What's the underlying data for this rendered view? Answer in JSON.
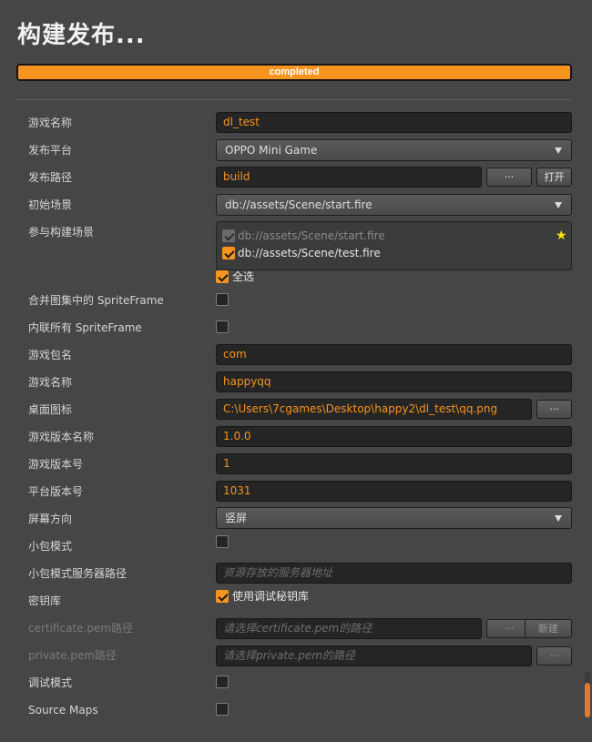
{
  "title": "构建发布...",
  "progress": {
    "text": "completed",
    "fraction": 1.0
  },
  "colors": {
    "accent": "#f7931f",
    "background": "#464646",
    "field": "#252525"
  },
  "fields": {
    "game_name_1": {
      "label": "游戏名称",
      "value": "dl_test"
    },
    "platform": {
      "label": "发布平台",
      "value": "OPPO Mini Game"
    },
    "build_path": {
      "label": "发布路径",
      "value": "build",
      "browse": "···",
      "open": "打开"
    },
    "start_scene": {
      "label": "初始场景",
      "value": "db://assets/Scene/start.fire"
    },
    "scenes": {
      "label": "参与构建场景",
      "items": [
        "db://assets/Scene/start.fire",
        "db://assets/Scene/test.fire"
      ],
      "select_all": "全选"
    },
    "merge_sprite": {
      "label": "合并图集中的 SpriteFrame"
    },
    "inline_sprite": {
      "label": "内联所有 SpriteFrame"
    },
    "package_name": {
      "label": "游戏包名",
      "value": "com"
    },
    "game_name_2": {
      "label": "游戏名称",
      "value": "happyqq"
    },
    "desktop_icon": {
      "label": "桌面图标",
      "value": "C:\\Users\\7cgames\\Desktop\\happy2\\dl_test\\qq.png",
      "browse": "···"
    },
    "version_name": {
      "label": "游戏版本名称",
      "value": "1.0.0"
    },
    "version_code": {
      "label": "游戏版本号",
      "value": "1"
    },
    "platform_version": {
      "label": "平台版本号",
      "value": "1031"
    },
    "orientation": {
      "label": "屏幕方向",
      "value": "竖屏"
    },
    "small_package": {
      "label": "小包模式"
    },
    "small_package_server": {
      "label": "小包模式服务器路径",
      "placeholder": "资源存放的服务器地址"
    },
    "keystore": {
      "label": "密钥库",
      "option": "使用调试秘钥库"
    },
    "certificate": {
      "label": "certificate.pem路径",
      "placeholder": "请选择certificate.pem的路径",
      "browse": "···",
      "create": "新建"
    },
    "private_key": {
      "label": "private.pem路径",
      "placeholder": "请选择private.pem的路径",
      "browse": "···"
    },
    "debug_mode": {
      "label": "调试模式"
    },
    "source_maps": {
      "label": "Source Maps"
    }
  }
}
